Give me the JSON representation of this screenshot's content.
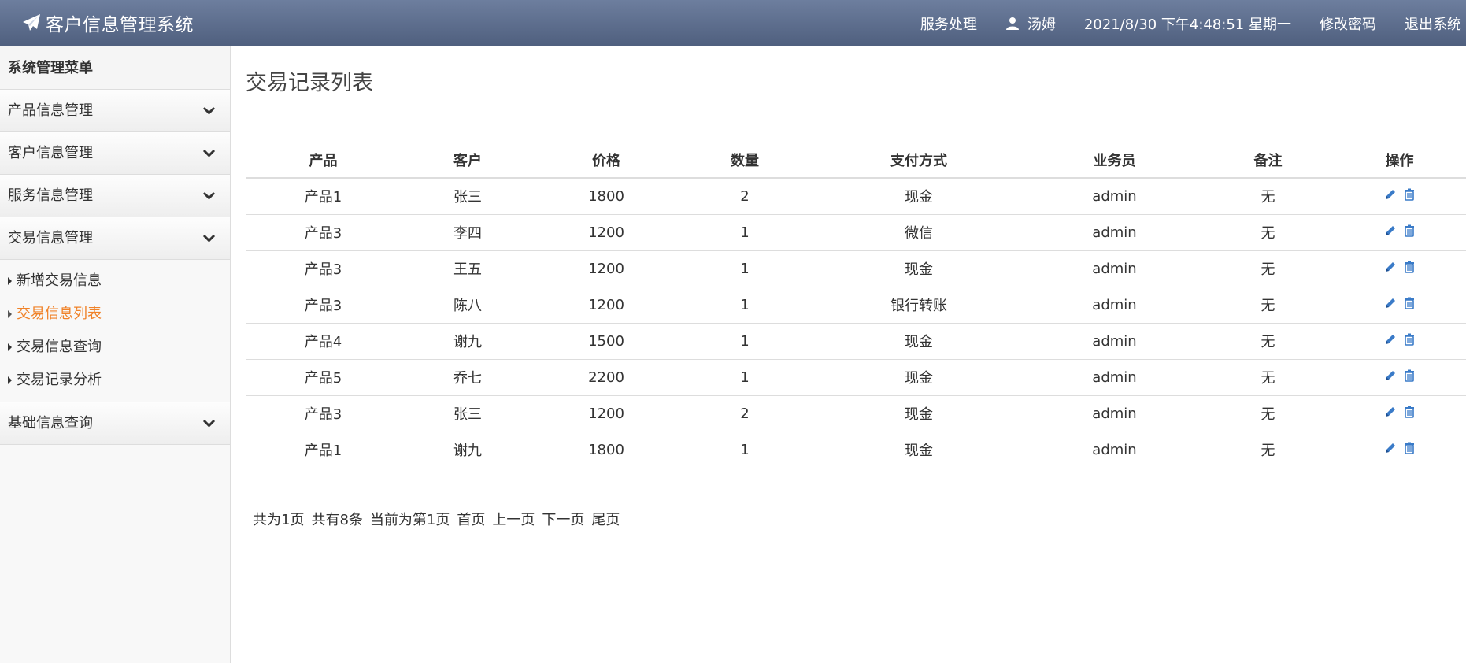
{
  "header": {
    "title": "客户信息管理系统",
    "nav": {
      "service": "服务处理",
      "user": "汤姆",
      "datetime": "2021/8/30 下午4:48:51 星期一",
      "change_password": "修改密码",
      "logout": "退出系统"
    }
  },
  "sidebar": {
    "heading": "系统管理菜单",
    "groups": [
      {
        "label": "产品信息管理"
      },
      {
        "label": "客户信息管理"
      },
      {
        "label": "服务信息管理"
      },
      {
        "label": "交易信息管理"
      },
      {
        "label": "基础信息查询"
      }
    ],
    "sub_items": [
      {
        "label": "新增交易信息"
      },
      {
        "label": "交易信息列表"
      },
      {
        "label": "交易信息查询"
      },
      {
        "label": "交易记录分析"
      }
    ]
  },
  "main": {
    "title": "交易记录列表",
    "columns": [
      "产品",
      "客户",
      "价格",
      "数量",
      "支付方式",
      "业务员",
      "备注",
      "操作"
    ],
    "rows": [
      [
        "产品1",
        "张三",
        "1800",
        "2",
        "现金",
        "admin",
        "无"
      ],
      [
        "产品3",
        "李四",
        "1200",
        "1",
        "微信",
        "admin",
        "无"
      ],
      [
        "产品3",
        "王五",
        "1200",
        "1",
        "现金",
        "admin",
        "无"
      ],
      [
        "产品3",
        "陈八",
        "1200",
        "1",
        "银行转账",
        "admin",
        "无"
      ],
      [
        "产品4",
        "谢九",
        "1500",
        "1",
        "现金",
        "admin",
        "无"
      ],
      [
        "产品5",
        "乔七",
        "2200",
        "1",
        "现金",
        "admin",
        "无"
      ],
      [
        "产品3",
        "张三",
        "1200",
        "2",
        "现金",
        "admin",
        "无"
      ],
      [
        "产品1",
        "谢九",
        "1800",
        "1",
        "现金",
        "admin",
        "无"
      ]
    ],
    "pager": {
      "total_pages": "共为1页",
      "total_records": "共有8条",
      "current": "当前为第1页",
      "first": "首页",
      "prev": "上一页",
      "next": "下一页",
      "last": "尾页"
    }
  },
  "colors": {
    "header_top": "#6d7e9e",
    "header_bottom": "#4f5f7e",
    "active_link": "#f08228",
    "icon_blue": "#3a7bc8"
  }
}
